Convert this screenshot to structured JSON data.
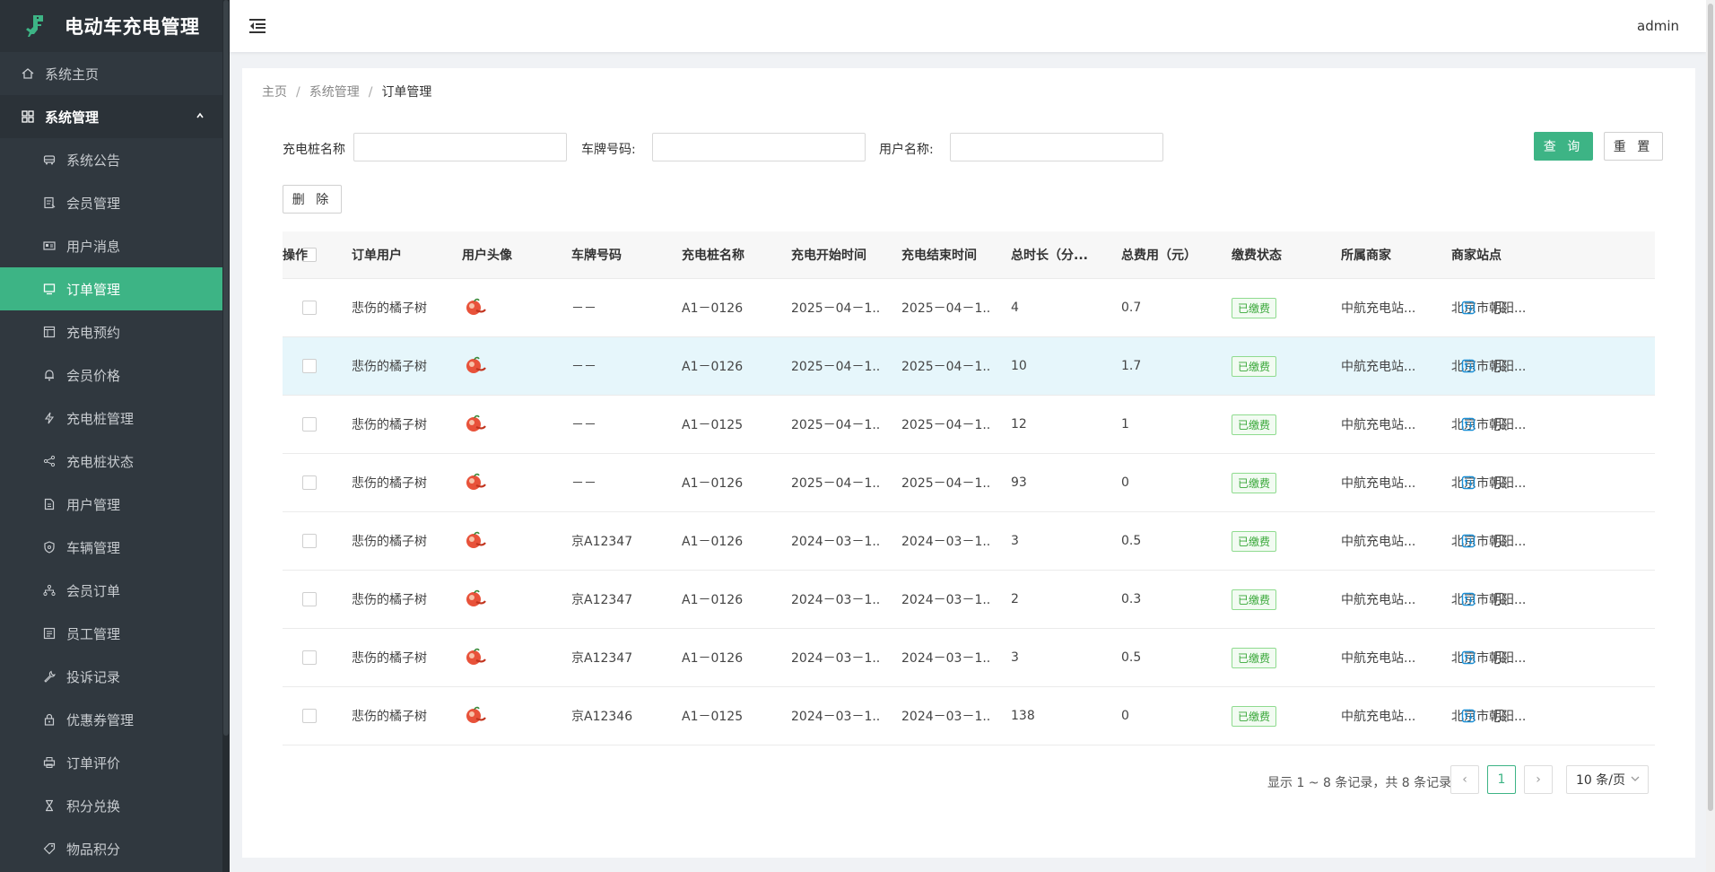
{
  "app": {
    "title": "电动车充电管理",
    "user": "admin"
  },
  "menu": [
    {
      "label": "系统主页",
      "icon": "home-icon",
      "kind": "top"
    },
    {
      "label": "系统管理",
      "icon": "grid-icon",
      "kind": "group"
    },
    {
      "label": "系统公告",
      "icon": "bus-icon",
      "kind": "sub"
    },
    {
      "label": "会员管理",
      "icon": "file-edit-icon",
      "kind": "sub"
    },
    {
      "label": "用户消息",
      "icon": "id-card-icon",
      "kind": "sub"
    },
    {
      "label": "订单管理",
      "icon": "monitor-icon",
      "kind": "sub",
      "active": true
    },
    {
      "label": "充电预约",
      "icon": "window-icon",
      "kind": "sub"
    },
    {
      "label": "会员价格",
      "icon": "bell-icon",
      "kind": "sub"
    },
    {
      "label": "充电桩管理",
      "icon": "bolt-icon",
      "kind": "sub"
    },
    {
      "label": "充电桩状态",
      "icon": "share-icon",
      "kind": "sub"
    },
    {
      "label": "用户管理",
      "icon": "document-icon",
      "kind": "sub"
    },
    {
      "label": "车辆管理",
      "icon": "shield-icon",
      "kind": "sub"
    },
    {
      "label": "会员订单",
      "icon": "org-chart-icon",
      "kind": "sub"
    },
    {
      "label": "员工管理",
      "icon": "list-box-icon",
      "kind": "sub"
    },
    {
      "label": "投诉记录",
      "icon": "wrench-icon",
      "kind": "sub"
    },
    {
      "label": "优惠券管理",
      "icon": "lock-icon",
      "kind": "sub"
    },
    {
      "label": "订单评价",
      "icon": "printer-icon",
      "kind": "sub"
    },
    {
      "label": "积分兑换",
      "icon": "hourglass-icon",
      "kind": "sub"
    },
    {
      "label": "物品积分",
      "icon": "tag-icon",
      "kind": "sub"
    }
  ],
  "breadcrumb": {
    "home": "主页",
    "section": "系统管理",
    "current": "订单管理",
    "sep": "/"
  },
  "filters": {
    "pile_name_label": "充电桩名称",
    "plate_label": "车牌号码:",
    "user_label": "用户名称:",
    "pile_name_value": "",
    "plate_value": "",
    "user_value": ""
  },
  "buttons": {
    "query": "查 询",
    "reset": "重 置",
    "delete": "删 除"
  },
  "table": {
    "headers": [
      "订单用户",
      "用户头像",
      "车牌号码",
      "充电桩名称",
      "充电开始时间",
      "充电结束时间",
      "总时长（分...",
      "总费用（元）",
      "缴费状态",
      "所属商家",
      "商家站点",
      "操作"
    ],
    "rows": [
      {
        "user": "悲伤的橘子树",
        "plate": "－－",
        "pile": "A1－0126",
        "start": "2025－04－1...",
        "end": "2025－04－1...",
        "duration": "4",
        "fee": "0.7",
        "status": "已缴费",
        "merchant": "中航充电站...",
        "site": "北京市朝阳..."
      },
      {
        "user": "悲伤的橘子树",
        "plate": "－－",
        "pile": "A1－0126",
        "start": "2025－04－1...",
        "end": "2025－04－1...",
        "duration": "10",
        "fee": "1.7",
        "status": "已缴费",
        "merchant": "中航充电站...",
        "site": "北京市朝阳..."
      },
      {
        "user": "悲伤的橘子树",
        "plate": "－－",
        "pile": "A1－0125",
        "start": "2025－04－1...",
        "end": "2025－04－1...",
        "duration": "12",
        "fee": "1",
        "status": "已缴费",
        "merchant": "中航充电站...",
        "site": "北京市朝阳..."
      },
      {
        "user": "悲伤的橘子树",
        "plate": "－－",
        "pile": "A1－0126",
        "start": "2025－04－1...",
        "end": "2025－04－1...",
        "duration": "93",
        "fee": "0",
        "status": "已缴费",
        "merchant": "中航充电站...",
        "site": "北京市朝阳..."
      },
      {
        "user": "悲伤的橘子树",
        "plate": "京A12347",
        "pile": "A1－0126",
        "start": "2024－03－1...",
        "end": "2024－03－1...",
        "duration": "3",
        "fee": "0.5",
        "status": "已缴费",
        "merchant": "中航充电站...",
        "site": "北京市朝阳..."
      },
      {
        "user": "悲伤的橘子树",
        "plate": "京A12347",
        "pile": "A1－0126",
        "start": "2024－03－1...",
        "end": "2024－03－1...",
        "duration": "2",
        "fee": "0.3",
        "status": "已缴费",
        "merchant": "中航充电站...",
        "site": "北京市朝阳..."
      },
      {
        "user": "悲伤的橘子树",
        "plate": "京A12347",
        "pile": "A1－0126",
        "start": "2024－03－1...",
        "end": "2024－03－1...",
        "duration": "3",
        "fee": "0.5",
        "status": "已缴费",
        "merchant": "中航充电站...",
        "site": "北京市朝阳..."
      },
      {
        "user": "悲伤的橘子树",
        "plate": "京A12346",
        "pile": "A1－0125",
        "start": "2024－03－1...",
        "end": "2024－03－1...",
        "duration": "138",
        "fee": "0",
        "status": "已缴费",
        "merchant": "中航充电站...",
        "site": "北京市朝阳..."
      }
    ]
  },
  "pagination": {
    "summary": "显示 1 ~ 8 条记录，共 8 条记录",
    "current_page": "1",
    "page_size": "10 条/页",
    "prev": "‹",
    "next": "›"
  },
  "colors": {
    "accent": "#3db485",
    "sidebar": "#30383f",
    "highlight_row": "#e6f6fb"
  }
}
